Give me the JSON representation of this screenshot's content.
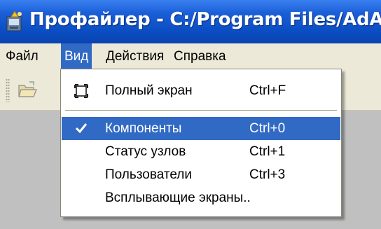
{
  "window": {
    "title": "Профайлер - C:/Program Files/AdAstra"
  },
  "menubar": {
    "items": [
      {
        "label": "Файл"
      },
      {
        "label": "Вид"
      },
      {
        "label": "Действия"
      },
      {
        "label": "Справка"
      }
    ],
    "open_menu": "Вид"
  },
  "view_menu": {
    "items": [
      {
        "label": "Полный экран",
        "shortcut": "Ctrl+F",
        "icon": "fullscreen-icon",
        "checked": false,
        "highlighted": false
      },
      {
        "label": "Компоненты",
        "shortcut": "Ctrl+0",
        "icon": "checkmark-icon",
        "checked": true,
        "highlighted": true
      },
      {
        "label": "Статус узлов",
        "shortcut": "Ctrl+1",
        "checked": false,
        "highlighted": false
      },
      {
        "label": "Пользователи",
        "shortcut": "Ctrl+3",
        "checked": false,
        "highlighted": false
      },
      {
        "label": "Всплывающие экраны..",
        "shortcut": "",
        "checked": false,
        "highlighted": false
      }
    ]
  },
  "toolbar": {
    "buttons": [
      {
        "icon": "open-folder-icon"
      }
    ]
  },
  "colors": {
    "titlebar": "#0b4ec4",
    "highlight": "#316ac5",
    "menubar": "#ece9d8",
    "workspace": "#c0c0c0"
  }
}
